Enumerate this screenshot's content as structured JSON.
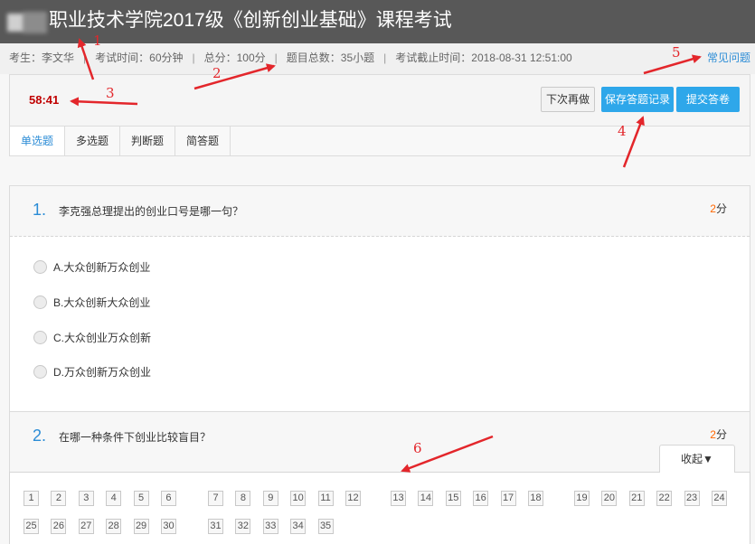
{
  "header": {
    "title": "职业技术学院2017级《创新创业基础》课程考试"
  },
  "info_bar": {
    "candidate": "考生：李文华",
    "duration": "考试时间：60分钟",
    "total_score": "总分：100分",
    "question_count": "题目总数：35小题",
    "deadline": "考试截止时间：2018-08-31 12:51:00",
    "separator": "|",
    "faq_link": "常见问题"
  },
  "control_panel": {
    "timer": "58:41",
    "later_button": "下次再做",
    "save_button": "保存答题记录",
    "submit_button": "提交答卷",
    "tabs": [
      {
        "label": "单选题",
        "active": true
      },
      {
        "label": "多选题",
        "active": false
      },
      {
        "label": "判断题",
        "active": false
      },
      {
        "label": "简答题",
        "active": false
      }
    ]
  },
  "questions": [
    {
      "number": "1.",
      "text": "李克强总理提出的创业口号是哪一句？",
      "score_value": "2",
      "score_unit": "分",
      "options": [
        {
          "label": "A.大众创新万众创业",
          "selected": false
        },
        {
          "label": "B.大众创新大众创业",
          "selected": false
        },
        {
          "label": "C.大众创业万众创新",
          "selected": false
        },
        {
          "label": "D.万众创新万众创业",
          "selected": false
        }
      ]
    },
    {
      "number": "2.",
      "text": "在哪一种条件下创业比较盲目？",
      "score_value": "2",
      "score_unit": "分"
    }
  ],
  "question_nav": {
    "collapse_label": "收起▼",
    "numbers": [
      "1",
      "2",
      "3",
      "4",
      "5",
      "6",
      "7",
      "8",
      "9",
      "10",
      "11",
      "12",
      "13",
      "14",
      "15",
      "16",
      "17",
      "18",
      "19",
      "20",
      "21",
      "22",
      "23",
      "24",
      "25",
      "26",
      "27",
      "28",
      "29",
      "30",
      "31",
      "32",
      "33",
      "34",
      "35"
    ]
  },
  "annotations": {
    "labels": [
      "1",
      "2",
      "3",
      "4",
      "5",
      "6"
    ]
  },
  "icons": {
    "logo": "blurred-logo",
    "option_radio": "radio-unchecked-icon",
    "annotation_arrow": "red-arrow-icon"
  },
  "colors": {
    "header_bg": "#585858",
    "accent_blue": "#2b8cd6",
    "button_blue": "#2ea7ea",
    "timer_red": "#c00000",
    "score_orange": "#ff6600",
    "annotation_red": "#e3262b"
  }
}
